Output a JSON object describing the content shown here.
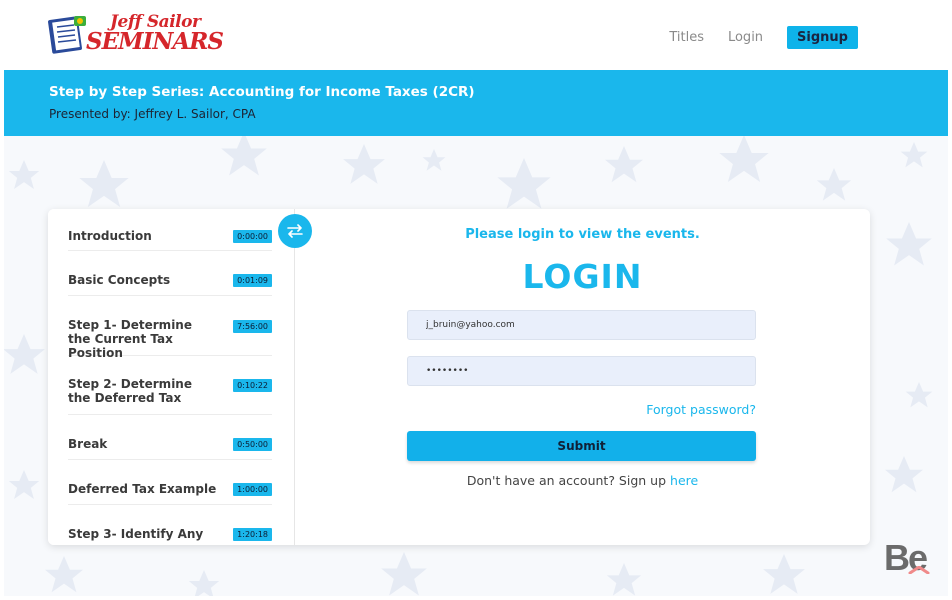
{
  "header": {
    "logo": {
      "line1": "Jeff Sailor",
      "line2": "SEMINARS"
    },
    "nav": {
      "titles": "Titles",
      "login": "Login",
      "signup": "Signup"
    }
  },
  "banner": {
    "title": "Step by Step Series: Accounting for Income Taxes (2CR)",
    "presenter": "Presented by: Jeffrey L. Sailor, CPA"
  },
  "sidebar": {
    "lessons": [
      {
        "label": "Introduction",
        "time": "0:00:00"
      },
      {
        "label": "Basic Concepts",
        "time": "0:01:09"
      },
      {
        "label": "Step 1- Determine the Current Tax Position",
        "time": "7:56:00"
      },
      {
        "label": "Step 2- Determine the Deferred Tax",
        "time": "0:10:22"
      },
      {
        "label": "Break",
        "time": "0:50:00"
      },
      {
        "label": "Deferred Tax Example",
        "time": "1:00:00"
      },
      {
        "label": "Step 3- Identify Any",
        "time": "1:20:18"
      }
    ]
  },
  "login": {
    "prompt": "Please login to view the events.",
    "heading": "LOGIN",
    "email_value": "j_bruin@yahoo.com",
    "password_value": "••••••••",
    "forgot": "Forgot password?",
    "submit": "Submit",
    "signup_text": "Don't have an account? Sign up",
    "signup_link": "here"
  },
  "watermark": "Be",
  "colors": {
    "accent": "#1ab7ec",
    "logo_red": "#d5262b"
  }
}
